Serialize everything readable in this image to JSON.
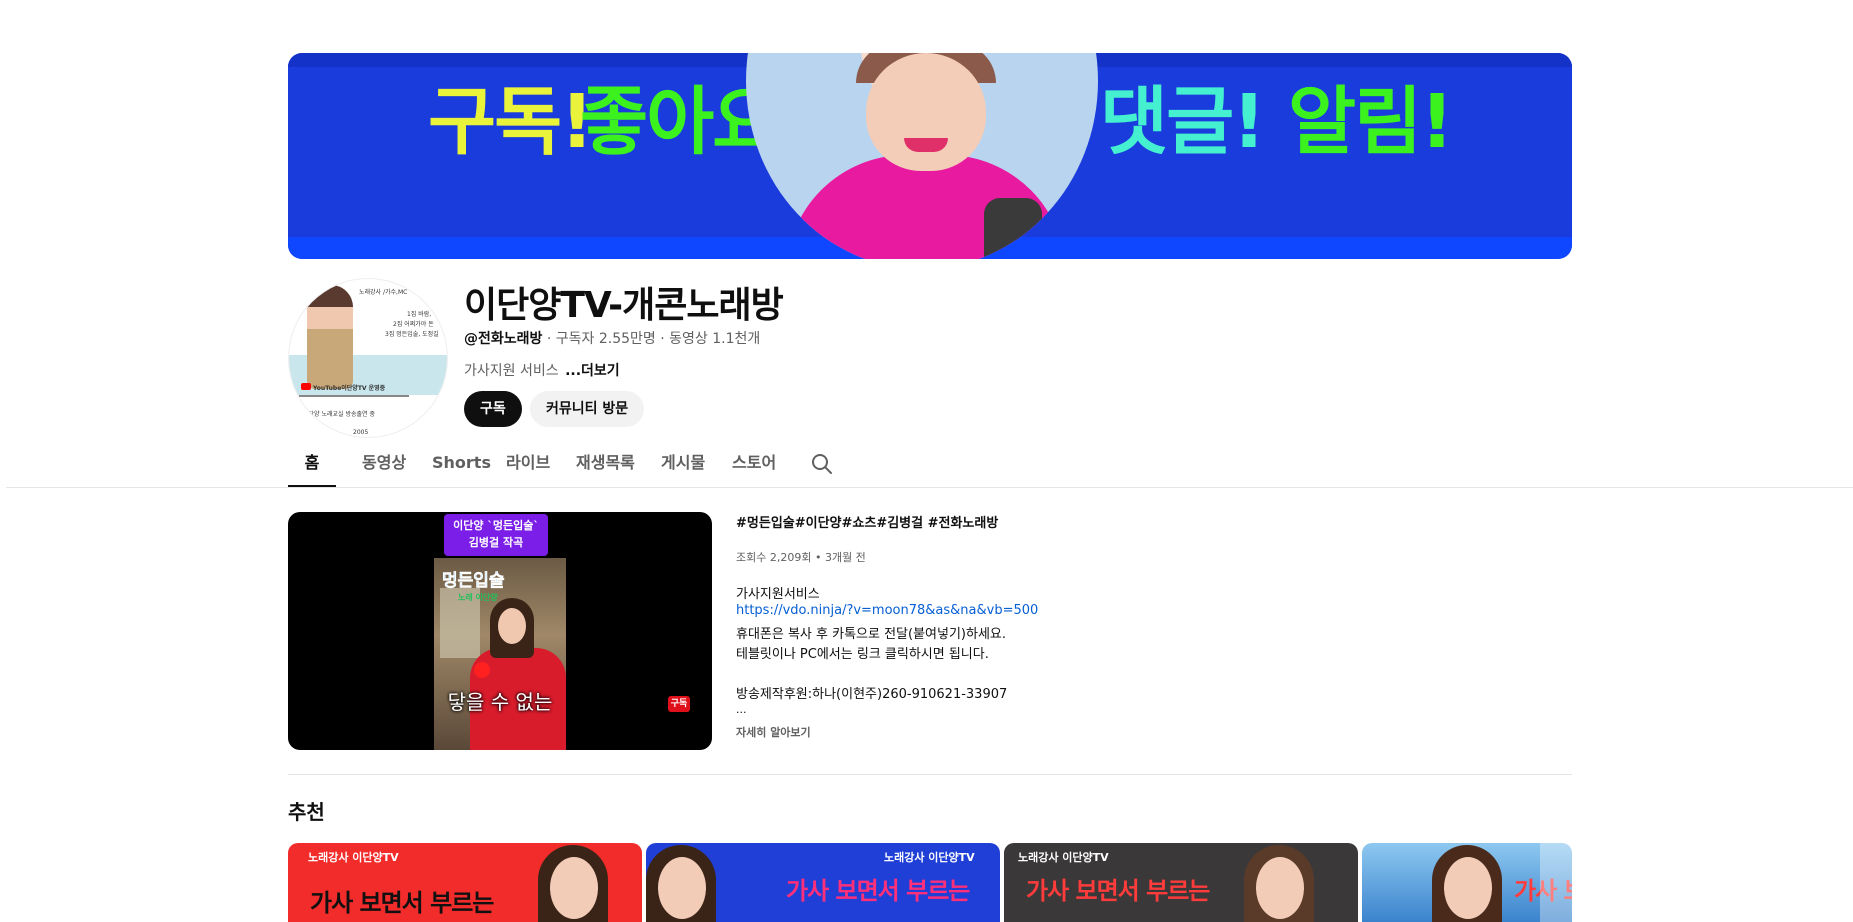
{
  "banner": {
    "text1": "구독!",
    "text2": "좋아요!",
    "text3": "댓글!",
    "text4": "알림!"
  },
  "avatar": {
    "line1": "노래강사 /가수,MC",
    "line2": "1집 바람,",
    "line3": "2집 어쩌가야 돈",
    "line4": "3집 멍든입술, 도정길",
    "brand": "YouTube이단양TV 운영중",
    "line5": "이단양 노래교실 방송출연 중",
    "year": "2005"
  },
  "channel": {
    "title": "이단양TV-개콘노래방",
    "handle": "@전화노래방",
    "meta_rest": " · 구독자 2.55만명 · 동영상 1.1천개",
    "description": "가사지원 서비스 ",
    "more": "...더보기",
    "subscribe_label": "구독",
    "community_label": "커뮤니티 방문"
  },
  "tabs": [
    {
      "label": "홈"
    },
    {
      "label": "동영상"
    },
    {
      "label": "Shorts"
    },
    {
      "label": "라이브"
    },
    {
      "label": "재생목록"
    },
    {
      "label": "게시물"
    },
    {
      "label": "스토어"
    }
  ],
  "featured": {
    "tag_line1": "이단양 `멍든입술`",
    "tag_line2": "김병걸 작곡",
    "poster_title": "멍든입술",
    "poster_sub": "노래 이단양",
    "caption": "닿을 수 없는",
    "sub_badge": "구독",
    "title": "#멍든입술#이단양#쇼츠#김병걸 #전화노래방",
    "stats": "조회수 2,209회 • 3개월 전",
    "desc_line1": "가사지원서비스",
    "desc_link": "https://vdo.ninja/?v=moon78&as&na&vb=500",
    "desc_line2": "휴대폰은 복사 후 카톡으로 전달(붙여넣기)하세요.",
    "desc_line3": "테블릿이나  PC에서는 링크 클릭하시면 됩니다.",
    "desc_line4": "방송제작후원:하나(이현주)260-910621-33907",
    "ellipsis": "...",
    "learn_more": "자세히 알아보기"
  },
  "recommended": {
    "section_title": "추천",
    "items": [
      {
        "brand": "노래강사 이단양TV",
        "headline": "가사 보면서 부르는"
      },
      {
        "brand": "노래강사 이단양TV",
        "headline": "가사 보면서 부르는"
      },
      {
        "brand": "노래강사 이단양TV",
        "headline": "가사 보면서 부르는"
      },
      {
        "brand": "",
        "headline": "가사 보"
      }
    ]
  },
  "colors": {
    "banner_bg": "#1a3cdc",
    "subscribe_bg": "#0f0f0f",
    "link": "#065fd4"
  }
}
